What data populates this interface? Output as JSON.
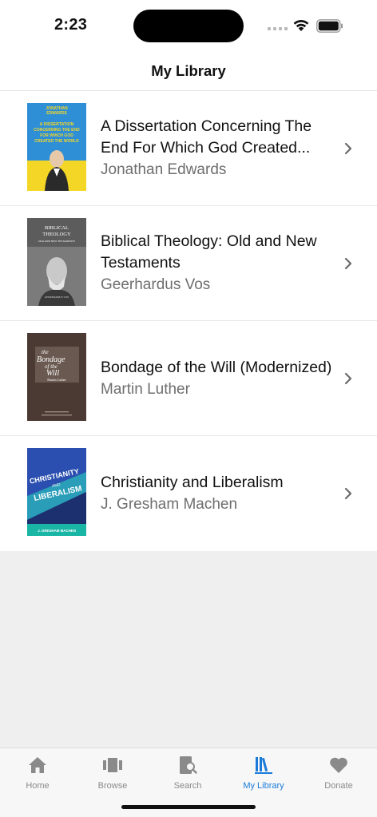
{
  "status_bar": {
    "time": "2:23"
  },
  "nav": {
    "title": "My Library"
  },
  "books": [
    {
      "title": "A Dissertation Concerning The End For Which God Created...",
      "author": "Jonathan Edwards",
      "cover_lines": [
        "JONATHAN",
        "EDWARDS",
        "A DISSERTATION",
        "CONCERNING THE END",
        "FOR WHICH GOD",
        "CREATED THE WORLD"
      ]
    },
    {
      "title": "Biblical Theology: Old and New Testaments",
      "author": "Geerhardus Vos",
      "cover_lines": [
        "BIBLICAL",
        "THEOLOGY",
        "OLD AND NEW TESTAMENTS",
        "GEERHARDUS VOS"
      ]
    },
    {
      "title": "Bondage of the Will (Modernized)",
      "author": "Martin Luther",
      "cover_lines": [
        "the",
        "Bondage",
        "of the",
        "Will",
        "Martin Luther"
      ]
    },
    {
      "title": "Christianity and Liberalism",
      "author": "J. Gresham Machen",
      "cover_lines": [
        "CHRISTIANITY",
        "AND",
        "LIBERALISM",
        "J. GRESHAM MACHEN"
      ]
    }
  ],
  "tabs": [
    {
      "label": "Home",
      "icon": "house-icon"
    },
    {
      "label": "Browse",
      "icon": "browse-icon"
    },
    {
      "label": "Search",
      "icon": "search-book-icon"
    },
    {
      "label": "My Library",
      "icon": "library-icon",
      "active": true
    },
    {
      "label": "Donate",
      "icon": "heart-icon"
    }
  ],
  "colors": {
    "accent": "#1a7ad9",
    "inactive": "#8a8a8a"
  }
}
